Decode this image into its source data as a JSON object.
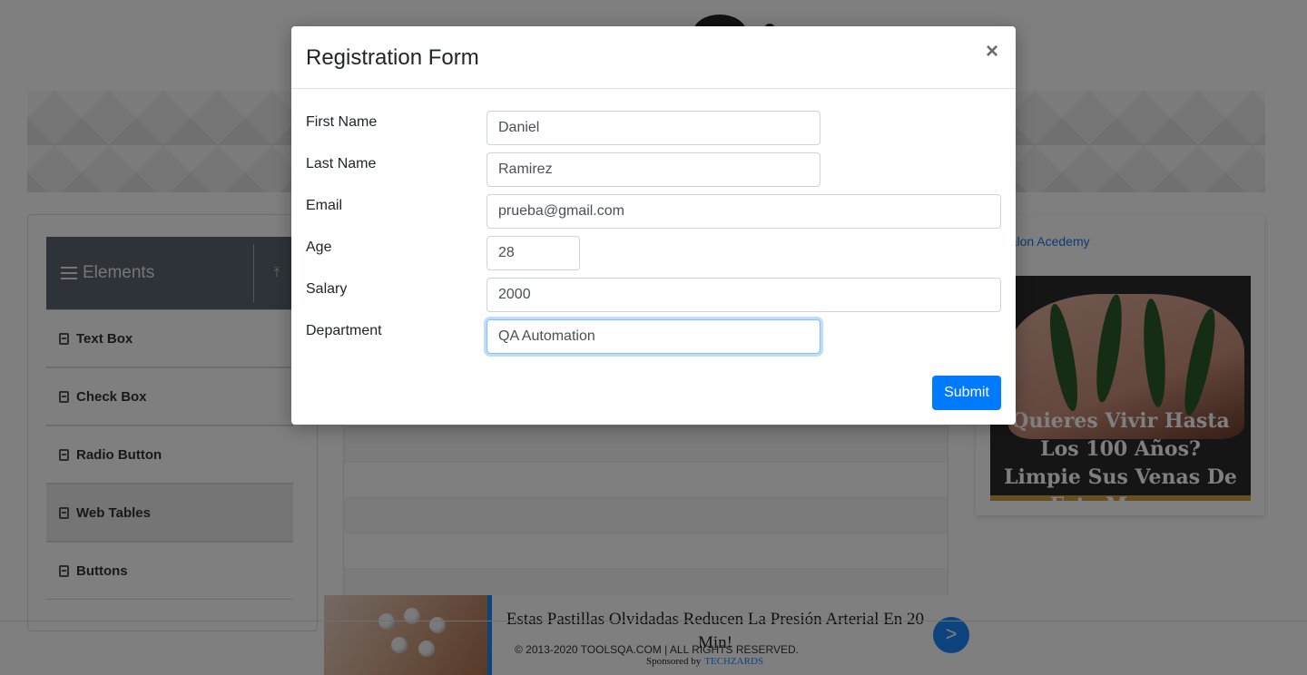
{
  "sidebar": {
    "group_title": "Elements",
    "items": [
      {
        "label": "Text Box"
      },
      {
        "label": "Check Box"
      },
      {
        "label": "Radio Button"
      },
      {
        "label": "Web Tables"
      },
      {
        "label": "Buttons"
      }
    ]
  },
  "right_ad": {
    "brand": "ntalon Acedemy",
    "headline": "Quieres Vivir Hasta Los 100 Años? Limpie Sus Venas De Esta Manera"
  },
  "bottom_ad": {
    "title": "Estas Pastillas Olvidadas Reducen La Presión Arterial En 20 Min!",
    "next_label": ">"
  },
  "footer": {
    "copyright": "© 2013-2020 TOOLSQA.COM | ALL RIGHTS RESERVED.",
    "sponsored_by": "Sponsored by",
    "sponsor_name": "TECHZARDS"
  },
  "modal": {
    "title": "Registration Form",
    "close_label": "×",
    "fields": {
      "first_name": {
        "label": "First Name",
        "value": "Daniel"
      },
      "last_name": {
        "label": "Last Name",
        "value": "Ramirez"
      },
      "email": {
        "label": "Email",
        "value": "prueba@gmail.com"
      },
      "age": {
        "label": "Age",
        "value": "28"
      },
      "salary": {
        "label": "Salary",
        "value": "2000"
      },
      "department": {
        "label": "Department",
        "value": "QA Automation"
      }
    },
    "submit_label": "Submit"
  },
  "colors": {
    "primary": "#007bff",
    "sidebar_header": "#5a6670",
    "overlay": "rgba(0,0,0,0.5)"
  }
}
